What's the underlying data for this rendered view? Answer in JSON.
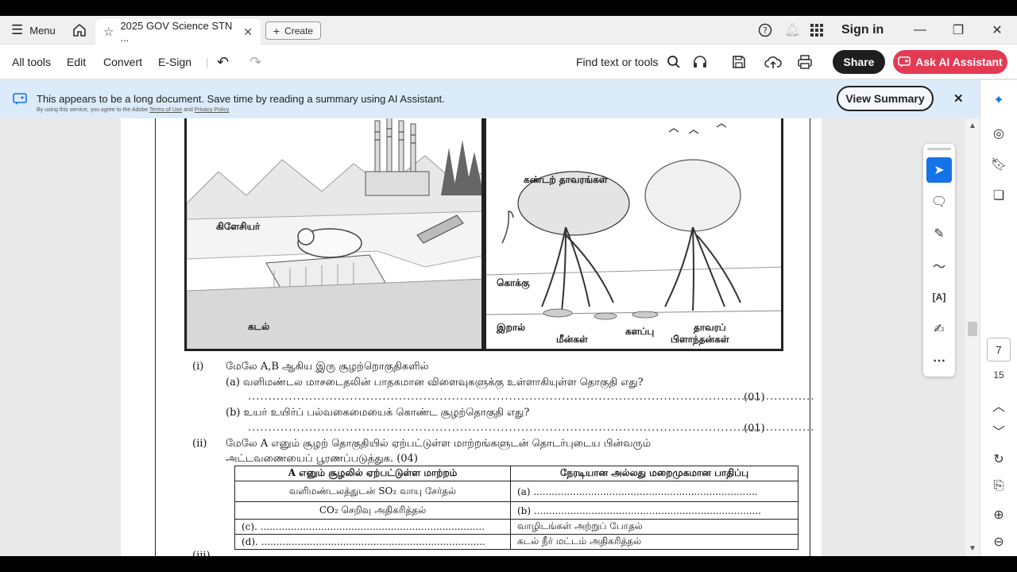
{
  "titlebar": {
    "menu_label": "Menu",
    "tab_title": "2025 GOV Science STN ...",
    "create_label": "Create",
    "sign_in_label": "Sign in"
  },
  "toolbar": {
    "all_tools": "All tools",
    "edit": "Edit",
    "convert": "Convert",
    "esign": "E-Sign",
    "find": "Find text or tools",
    "share": "Share",
    "ask_ai": "Ask AI Assistant"
  },
  "banner": {
    "message": "This appears to be a long document. Save time by reading a summary using AI Assistant.",
    "sub_prefix": "By using this service, you agree to the Adobe",
    "terms": "Terms of Use",
    "and": "and",
    "privacy": "Privacy Policy",
    "view_summary": "View Summary"
  },
  "figure": {
    "label_glacier": "கிளேசியர்",
    "label_sea": "கடல்",
    "label_mangrove": "கண்டற் தாவரங்கள்",
    "label_stork": "கொக்கு",
    "label_prawn": "இறால்",
    "label_fish": "மீன்கள்",
    "label_mud": "களப்பு",
    "label_plankton_1": "தாவரப்",
    "label_plankton_2": "பிளாந்தன்கள்"
  },
  "questions": {
    "q1_num": "(i)",
    "q1_text": "மேலே A,B ஆகிய இரு சூழற்றொகுதிகளில்",
    "q1a": "(a) வளிமண்டல மாசடைதலின் பாதகமான விளைவுகளுக்கு உள்ளாகியுள்ள தொகுதி எது?",
    "q1a_marks": "(01)",
    "q1b": "(b) உயர் உயிர்ப் பல்வகைமையைக் கொண்ட சூழற்தொகுதி எது?",
    "q1b_marks": "(01)",
    "q2_num": "(ii)",
    "q2_line1": "மேலே A எனும் சூழற் தொகுதியில் ஏற்பட்டுள்ள மாற்றங்களுடன் தொடர்புடைய பின்வரும்",
    "q2_line2": "அட்டவணையைப் பூரணப்படுத்துக. (04)",
    "table_header_left": "A எனும் சூழலில் ஏற்பட்டுள்ள மாற்றம்",
    "table_header_right": "நேரடியான அல்லது மறைமுகமான பாதிப்பு",
    "row1_left": "வளிமண்டலத்துடன் SO₂ வாயு சேர்தல்",
    "row1_right": "(a) ..........................................................................",
    "row2_left": "CO₂ செறிவு அதிகரித்தல்",
    "row2_right": "(b) ...........................................................................",
    "row3_left": "(c). ..........................................................................",
    "row3_right": "வாழிடங்கள் அற்றுப் போதல்",
    "row4_left": "(d). ..........................................................................",
    "row4_right": "கடல் நீர் மட்டம் அதிகரித்தல்",
    "q3_num": "(iii)"
  },
  "nav": {
    "current_page": "7",
    "total_pages": "15"
  },
  "colors": {
    "ai_button": "#e43b54",
    "banner_bg": "#dcebf9",
    "active_tool": "#1473e6"
  }
}
